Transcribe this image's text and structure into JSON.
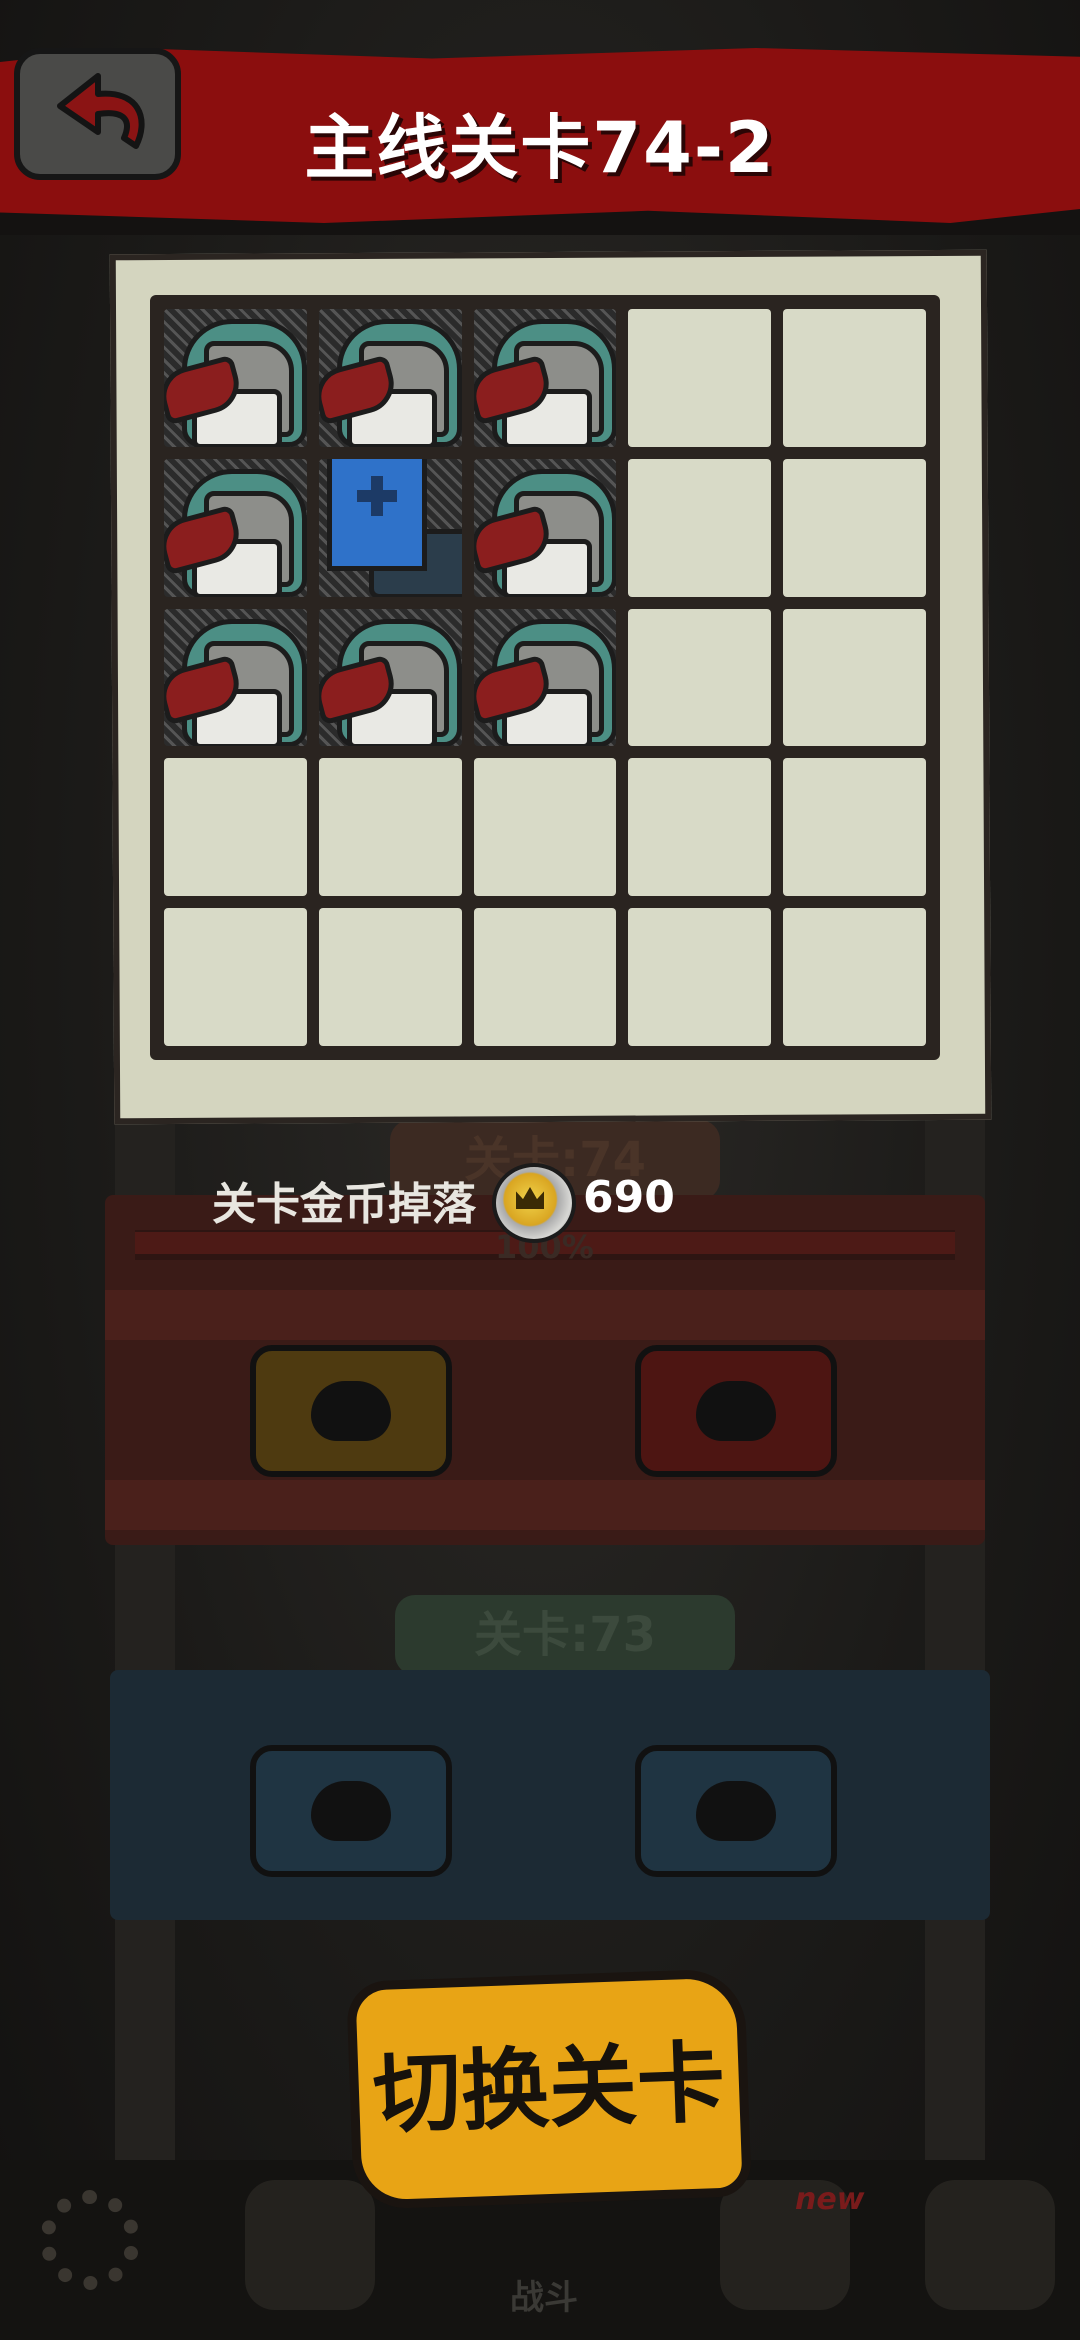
{
  "header": {
    "title": "主线关卡74-2"
  },
  "board": {
    "rows": 5,
    "cols": 5,
    "cells": [
      "knight",
      "knight",
      "knight",
      "empty",
      "empty",
      "knight",
      "standard-bearer",
      "knight",
      "empty",
      "empty",
      "knight",
      "knight",
      "knight",
      "empty",
      "empty",
      "empty",
      "empty",
      "empty",
      "empty",
      "empty",
      "empty",
      "empty",
      "empty",
      "empty",
      "empty"
    ]
  },
  "drop": {
    "label": "关卡金币掉落",
    "coin_value": "690",
    "icon": "crown-coin-icon"
  },
  "background": {
    "stage_tag_74": "关卡:74",
    "stage_tag_73": "关卡:73",
    "progress_text": "100%"
  },
  "actions": {
    "switch_label": "切换关卡"
  },
  "nav": {
    "battle_label": "战斗",
    "new_badge": "new"
  },
  "colors": {
    "banner": "#8b0e0e",
    "button": "#e8a415",
    "paper": "#d4d5bf"
  }
}
